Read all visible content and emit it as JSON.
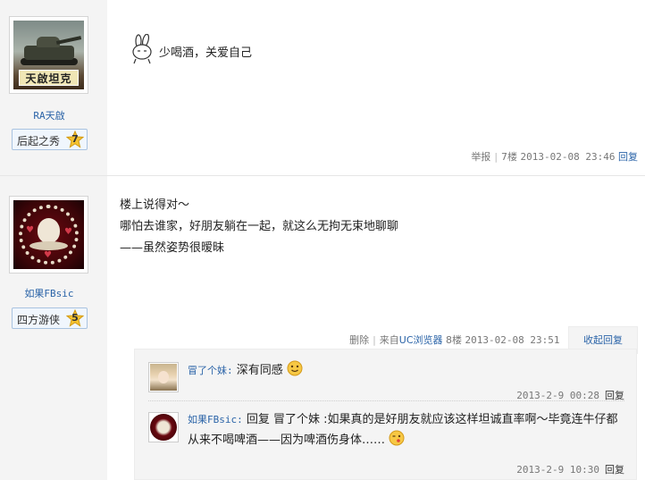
{
  "posts": [
    {
      "avatar_label": "天啟坦克",
      "username": "RA天啟",
      "rank": {
        "title": "后起之秀",
        "level": "7"
      },
      "content_lines": [
        "少喝酒，关爱自己"
      ],
      "meta": {
        "report": "举报",
        "floor": "7楼",
        "datetime": "2013-02-08 23:46",
        "reply": "回复"
      }
    },
    {
      "username": "如果FBsic",
      "rank": {
        "title": "四方游侠",
        "level": "5"
      },
      "content_lines": [
        "楼上说得对～",
        "哪怕去谁家，好朋友躺在一起，就这么无拘无束地聊聊",
        "——虽然姿势很暧昧"
      ],
      "meta": {
        "delete": "删除",
        "from_prefix": "来自",
        "from_app": "UC浏览器",
        "floor": "8楼",
        "datetime": "2013-02-08 23:51",
        "collapse": "收起回复"
      },
      "replies": [
        {
          "author": "冒了个妹:",
          "text": "深有同感",
          "date": "2013-2-9 00:28",
          "reply": "回复"
        },
        {
          "author": "如果FBsic:",
          "text": "回复 冒了个妹 :如果真的是好朋友就应该这样坦诚直率啊～毕竟连牛仔都从来不喝啤酒——因为啤酒伤身体……",
          "date": "2013-2-9 10:30",
          "reply": "回复"
        }
      ]
    }
  ],
  "colors": {
    "link": "#2b64a8",
    "sidebar": "#f4f4f4",
    "star": "#f5c330"
  },
  "icons": [
    "rabbit-emoticon",
    "star-badge-icon",
    "smile-emoji-icon",
    "kiss-emoji-icon"
  ]
}
